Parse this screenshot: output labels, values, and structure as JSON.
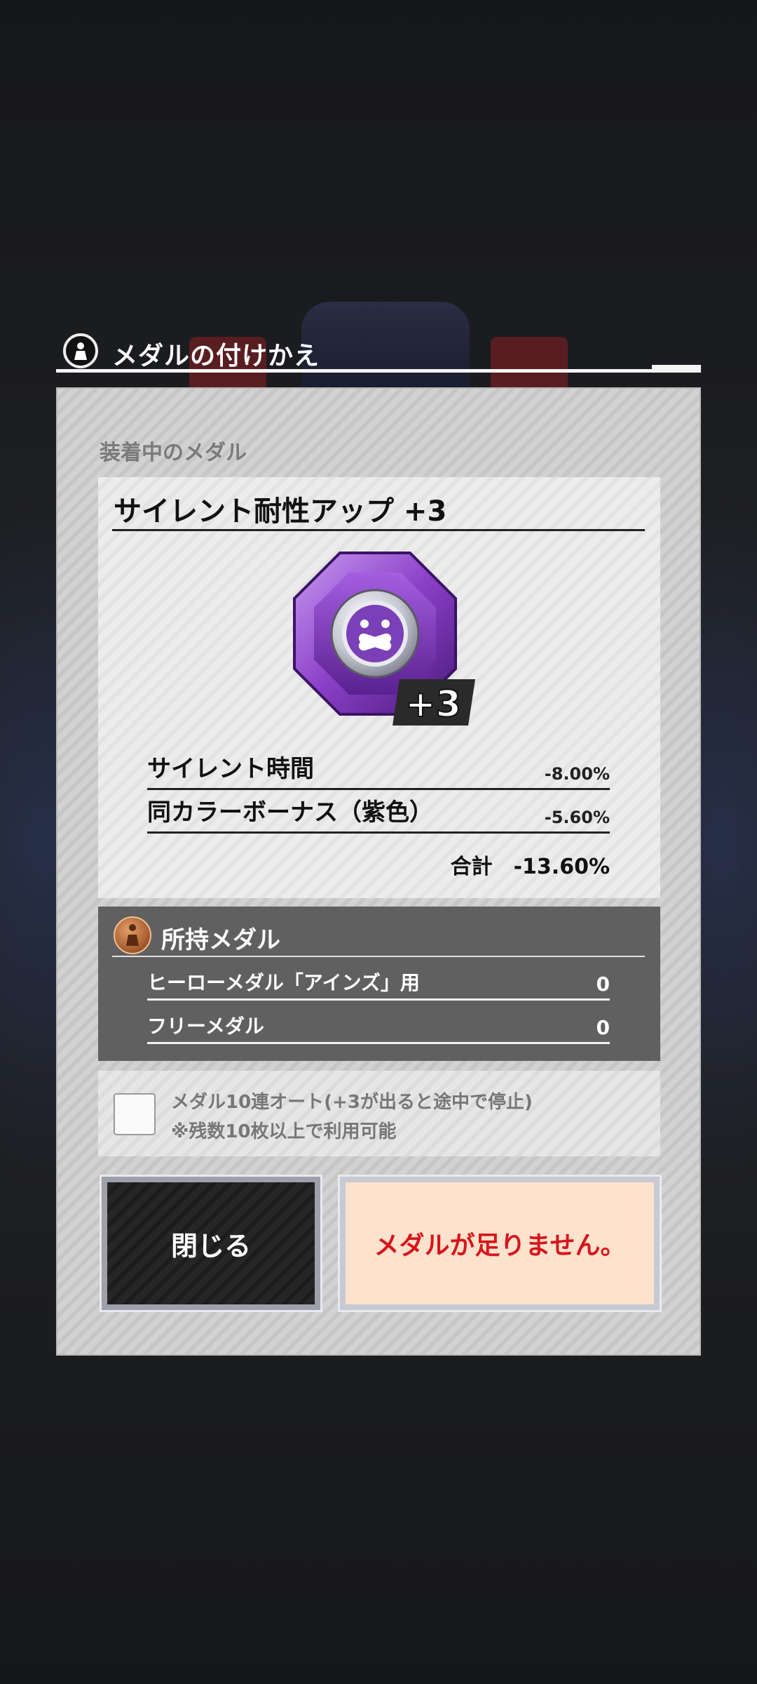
{
  "dialog": {
    "title": "メダルの付けかえ",
    "header_icon": "medal-figure-icon",
    "equipped_caption": "装着中のメダル",
    "medal": {
      "name": "サイレント耐性アップ +3",
      "plus_badge": "+3",
      "icon": "silence-face-icon",
      "gem_color": "#8a3fc7"
    },
    "stats": [
      {
        "label": "サイレント時間",
        "value": "-8.00%"
      },
      {
        "label": "同カラーボーナス（紫色）",
        "value": "-5.60%"
      }
    ],
    "total": {
      "label": "合計",
      "value": "-13.60%"
    },
    "owned": {
      "title": "所持メダル",
      "icon": "bronze-medal-icon",
      "rows": [
        {
          "label": "ヒーローメダル「アインズ」用",
          "value": "0"
        },
        {
          "label": "フリーメダル",
          "value": "0"
        }
      ]
    },
    "auto": {
      "line1": "メダル10連オート(+3が出ると途中で停止)",
      "line2": "※残数10枚以上で利用可能",
      "checked": false
    },
    "buttons": {
      "close_label": "閉じる",
      "insufficient_label": "メダルが足りません。"
    },
    "colors": {
      "warning_text": "#d8141c",
      "warning_bg": "#fde2cd"
    }
  }
}
